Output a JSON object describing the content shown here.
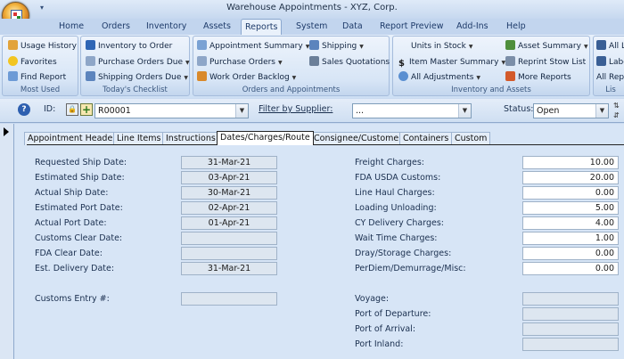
{
  "window": {
    "title": "Warehouse Appointments - XYZ, Corp."
  },
  "ribbon_tabs": [
    "Home",
    "Orders",
    "Inventory",
    "Assets",
    "Reports",
    "System",
    "Data",
    "Report Preview",
    "Add-Ins",
    "Help"
  ],
  "active_tab": "Reports",
  "groups": {
    "most_used": {
      "label": "Most Used",
      "items": [
        "Usage History",
        "Favorites",
        "Find Report"
      ]
    },
    "checklist": {
      "label": "Today's Checklist",
      "items": [
        "Inventory to Order",
        "Purchase Orders Due",
        "Shipping Orders Due"
      ]
    },
    "orders": {
      "label": "Orders and Appointments",
      "items": [
        "Appointment Summary",
        "Purchase Orders",
        "Work Order Backlog",
        "Shipping",
        "Sales Quotations"
      ]
    },
    "inventory": {
      "label": "Inventory and Assets",
      "items": [
        "Units in Stock",
        "Item Master Summary",
        "All Adjustments",
        "Asset Summary",
        "Reprint Stow List",
        "More Reports"
      ]
    },
    "lists": {
      "label": "Lis",
      "items": [
        "All L",
        "Labe",
        "All Repo"
      ]
    }
  },
  "toolbar": {
    "id_label": "ID:",
    "id_value": "R00001",
    "supplier_label": "Filter by Supplier:",
    "supplier_value": "...",
    "status_label": "Status:",
    "status_value": "Open"
  },
  "form_tabs": [
    "Appointment Header",
    "Line Items",
    "Instructions",
    "Dates/Charges/Route",
    "Consignee/Customer",
    "Containers",
    "Custom"
  ],
  "active_form_tab": "Dates/Charges/Route",
  "dates": [
    {
      "label": "Requested Ship Date:",
      "value": "31-Mar-21"
    },
    {
      "label": "Estimated Ship Date:",
      "value": "03-Apr-21"
    },
    {
      "label": "Actual Ship Date:",
      "value": "30-Mar-21"
    },
    {
      "label": "Estimated Port Date:",
      "value": "02-Apr-21"
    },
    {
      "label": "Actual Port Date:",
      "value": "01-Apr-21"
    },
    {
      "label": "Customs Clear Date:",
      "value": ""
    },
    {
      "label": "FDA Clear Date:",
      "value": ""
    },
    {
      "label": "Est. Delivery Date:",
      "value": "31-Mar-21"
    }
  ],
  "customs_entry": {
    "label": "Customs Entry #:",
    "value": ""
  },
  "charges": [
    {
      "label": "Freight Charges:",
      "value": "10.00"
    },
    {
      "label": "FDA USDA Customs:",
      "value": "20.00"
    },
    {
      "label": "Line Haul Charges:",
      "value": "0.00"
    },
    {
      "label": "Loading Unloading:",
      "value": "5.00"
    },
    {
      "label": "CY Delivery Charges:",
      "value": "4.00"
    },
    {
      "label": "Wait Time Charges:",
      "value": "1.00"
    },
    {
      "label": "Dray/Storage Charges:",
      "value": "0.00"
    },
    {
      "label": "PerDiem/Demurrage/Misc:",
      "value": "0.00"
    }
  ],
  "route": [
    {
      "label": "Voyage:",
      "value": ""
    },
    {
      "label": "Port of Departure:",
      "value": ""
    },
    {
      "label": "Port of Arrival:",
      "value": ""
    },
    {
      "label": "Port Inland:",
      "value": ""
    }
  ]
}
